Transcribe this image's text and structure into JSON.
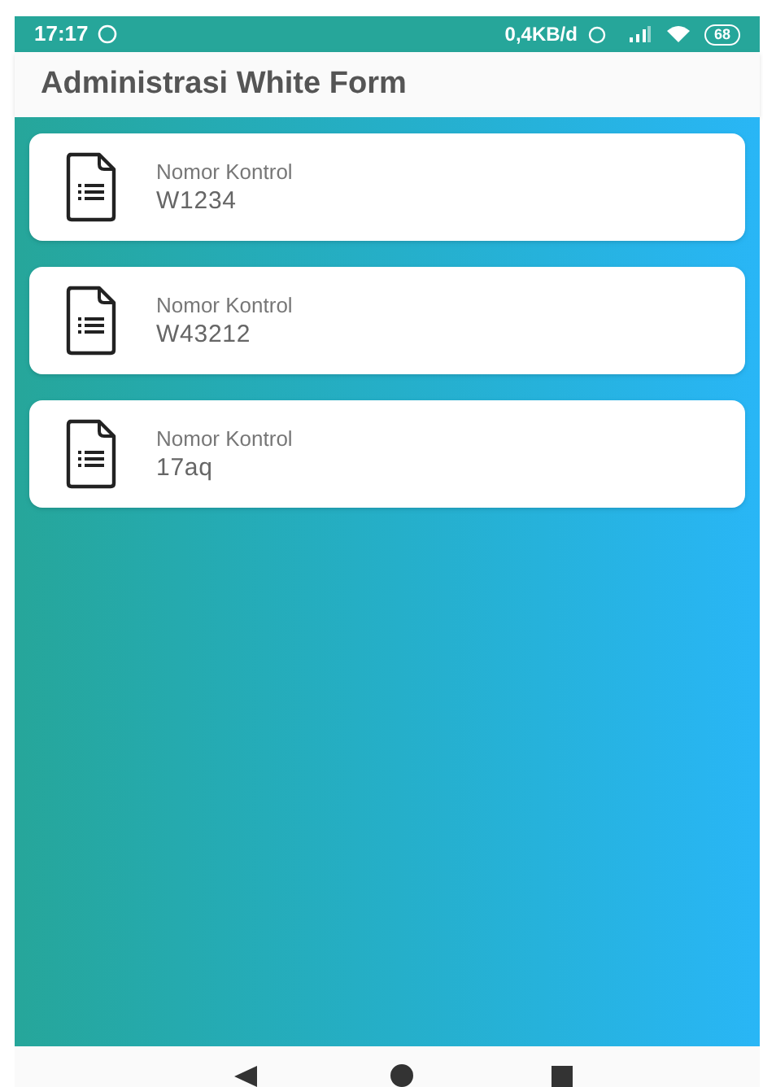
{
  "status_bar": {
    "time": "17:17",
    "speed": "0,4KB/d",
    "battery": "68"
  },
  "app_bar": {
    "title": "Administrasi White Form"
  },
  "items": [
    {
      "label": "Nomor Kontrol",
      "value": "W1234"
    },
    {
      "label": "Nomor Kontrol",
      "value": "W43212"
    },
    {
      "label": "Nomor Kontrol",
      "value": "17aq"
    }
  ]
}
